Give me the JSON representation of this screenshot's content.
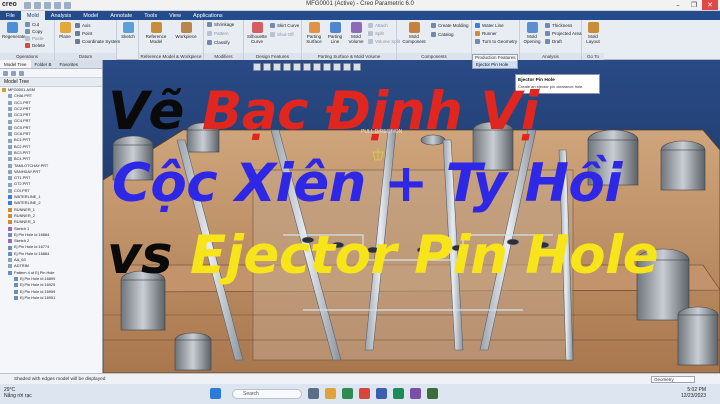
{
  "app": {
    "logo": "creo",
    "title": "MFG0001 (Active) - Creo Parametric 6.0",
    "window_controls": [
      "–",
      "❐",
      "✕"
    ]
  },
  "tabs": [
    "File",
    "Mold",
    "Analysis",
    "Model",
    "Annotate",
    "Tools",
    "View",
    "Applications"
  ],
  "active_tab": "Mold",
  "ribbon": {
    "groups": [
      {
        "name": "Operations",
        "buttons": [
          "Regenerate"
        ],
        "small": [
          "Cut",
          "Copy",
          "Paste",
          "Delete"
        ]
      },
      {
        "name": "Datum",
        "buttons": [
          "Plane"
        ],
        "small": [
          "Axis",
          "Point",
          "Coordinate System"
        ]
      },
      {
        "name": "",
        "buttons": [
          "Sketch"
        ],
        "small": []
      },
      {
        "name": "Reference Model & Workpiece",
        "buttons": [
          "Reference Model",
          "Workpiece"
        ],
        "small": []
      },
      {
        "name": "Modifiers",
        "buttons": [],
        "small": [
          "Shrinkage",
          "Pattern",
          "Classify"
        ]
      },
      {
        "name": "Design Features",
        "buttons": [
          "Silhouette Curve"
        ],
        "small": [
          "Skirt Curve",
          "Shut-Off"
        ]
      },
      {
        "name": "Parting Surface & Mold Volume",
        "buttons": [
          "Parting Surface",
          "Parting Line",
          "Mold Volume"
        ],
        "small": [
          "Attach",
          "Split",
          "Volume Split"
        ]
      },
      {
        "name": "Components",
        "buttons": [
          "Mold Component"
        ],
        "small": [
          "Create Molding",
          "Catalog"
        ]
      },
      {
        "name": "Production Features",
        "buttons": [],
        "small": [
          "Water Line",
          "Runner",
          "Turn to Geometry"
        ]
      },
      {
        "name": "Analysis",
        "buttons": [
          "Mold Opening"
        ],
        "small": [
          "Thickness",
          "Projected Area",
          "Draft"
        ]
      },
      {
        "name": "Go To",
        "buttons": [
          "Mold Layout"
        ],
        "small": []
      }
    ]
  },
  "panel": {
    "tabs": [
      "Model Tree",
      "Folder B",
      "Favorites"
    ],
    "header": "Model Tree",
    "items": [
      "MFG0001.ASM",
      "CHAI.PRT",
      "GC1.PRT",
      "GC2.PRT",
      "GC3.PRT",
      "GC4.PRT",
      "GC5.PRT",
      "GC6.PRT",
      "BC1.PRT",
      "BC2.PRT",
      "BC3.PRT",
      "BC4.PRT",
      "TAMLOTCHAY.PRT",
      "VANHDAY.PRT",
      "GT1.PRT",
      "GT2.PRT",
      "COI.PRT",
      "WATERLINE_1",
      "WATERLINE_2",
      "RUNNER_1",
      "RUNNER_2",
      "RUNNER_3",
      "Sketch 1",
      "Ej Pin Hole id 16684",
      "Sketch 2",
      "Ej Pin Hole id 16774",
      "Ej Pin Hole id 16864",
      "AA_63",
      "ADTRIM",
      "Pattern 4 of Ej Pin Hole",
      "Ej Pin Hole id 16899",
      "Ej Pin Hole id 16929",
      "Ej Pin Hole id 16959",
      "Ej Pin Hole id 16951"
    ]
  },
  "viewport": {
    "label": "PULL DIRECTION",
    "dropdown_header": "Production Features",
    "dropdown_item": "Ejector Pin Hole",
    "tooltip_title": "Ejector Pin Hole",
    "tooltip_desc": "Create an ejector pin clearance hole."
  },
  "overlay": {
    "line1_a": "Vẽ ",
    "line1_b": "Bạc Định Vị",
    "line2": "Cộc Xiên + Ty Hồi",
    "line3_a": "vs ",
    "line3_b": "Ejector Pin Hole"
  },
  "status": {
    "message": "Shaded with edges model will be displayed",
    "filter": "Geometry"
  },
  "taskbar": {
    "weather_temp": "29°C",
    "weather_desc": "Nắng rời rạc",
    "search": "Search",
    "time": "5:02 PM",
    "date": "12/23/2023"
  },
  "colors": {
    "accent": "#244c8c",
    "overlay_black": "#0a0a0a",
    "overlay_red": "#e0261f",
    "overlay_blue": "#2f27e6",
    "overlay_yellow": "#f7e51a"
  }
}
